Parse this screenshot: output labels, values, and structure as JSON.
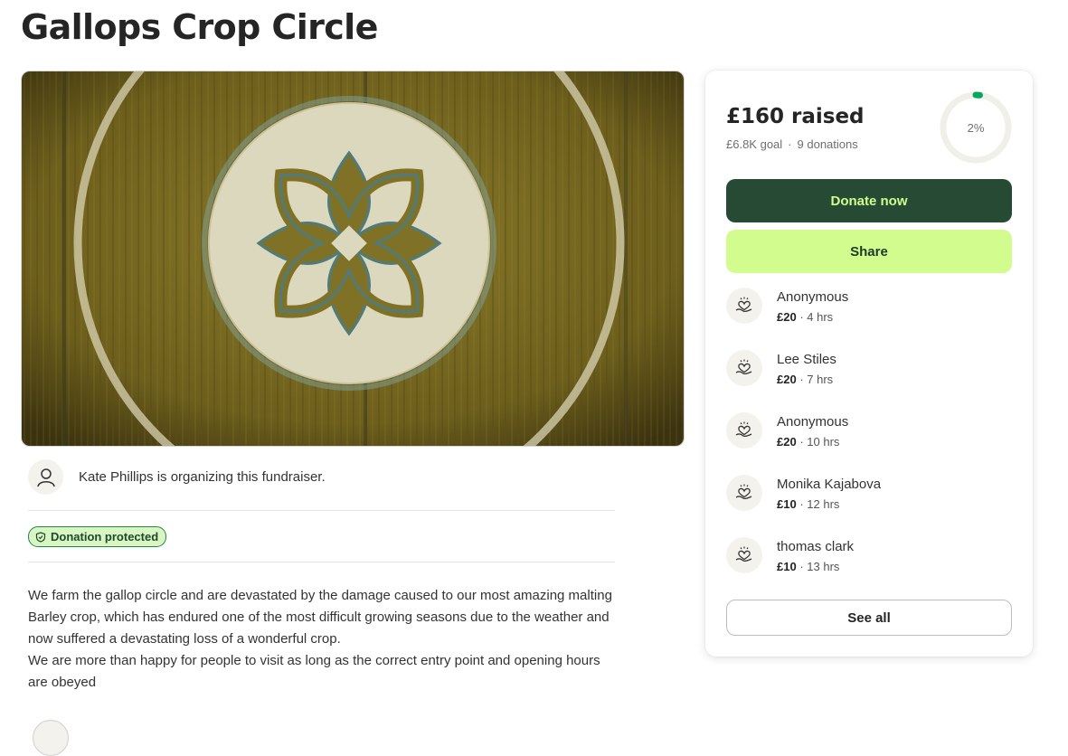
{
  "page": {
    "title": "Gallops Crop Circle"
  },
  "organizer": {
    "text": "Kate Phillips is organizing this fundraiser."
  },
  "badge": {
    "label": "Donation protected"
  },
  "description": {
    "p1": "We farm the gallop circle and are devastated by the damage caused to our most amazing malting Barley crop, which has endured one of the most difficult growing seasons due to the weather and now suffered a devastating loss of a wonderful crop.",
    "p2": "We are more than happy for people to visit as long as the correct entry point and opening hours are obeyed"
  },
  "sidebar": {
    "raised": "£160 raised",
    "goal": "£6.8K goal",
    "separator": "·",
    "donations_count": "9 donations",
    "progress_label": "2%",
    "progress_fraction": 0.02,
    "donate_label": "Donate now",
    "share_label": "Share",
    "see_all_label": "See all",
    "donations": [
      {
        "name": "Anonymous",
        "amount": "£20",
        "time": "· 4 hrs"
      },
      {
        "name": "Lee Stiles",
        "amount": "£20",
        "time": "· 7 hrs"
      },
      {
        "name": "Anonymous",
        "amount": "£20",
        "time": "· 10 hrs"
      },
      {
        "name": "Monika Kajabova",
        "amount": "£10",
        "time": "· 12 hrs"
      },
      {
        "name": "thomas clark",
        "amount": "£10",
        "time": "· 13 hrs"
      }
    ]
  },
  "colors": {
    "primary": "#264a34",
    "accent": "#d2fc8e",
    "progress": "#02a95c",
    "badge_bg": "#d9f5c4"
  },
  "icons": {
    "avatar": "person-icon",
    "badge": "shield-icon",
    "donation": "heart-hand-icon"
  }
}
